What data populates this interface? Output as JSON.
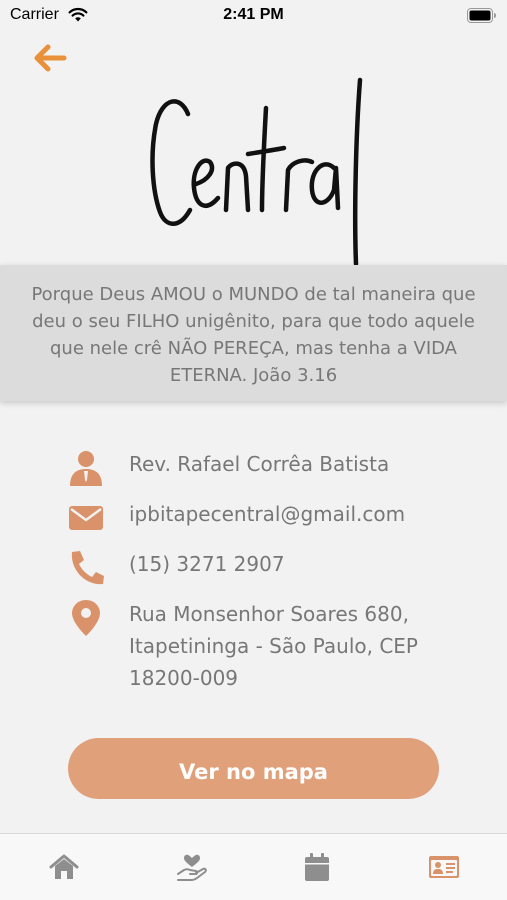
{
  "status_bar": {
    "carrier": "Carrier",
    "time": "2:41 PM"
  },
  "verse": "Porque Deus AMOU o MUNDO de tal maneira que deu o seu FILHO unigênito, para que todo aquele que nele crê NÃO PEREÇA, mas tenha a VIDA ETERNA. João 3.16",
  "contact": {
    "pastor": "Rev. Rafael Corrêa Batista",
    "email": "ipbitapecentral@gmail.com",
    "phone": "(15) 3271 2907",
    "address": "Rua Monsenhor Soares 680, Itapetininga - São Paulo, CEP 18200-009"
  },
  "map_button_label": "Ver no mapa",
  "colors": {
    "accent": "#e0a07a",
    "back_arrow": "#e8913a",
    "icon": "#d9926a",
    "tab_inactive": "#8e8e8e"
  },
  "tabs": [
    {
      "icon": "home-icon"
    },
    {
      "icon": "hand-heart-icon"
    },
    {
      "icon": "calendar-icon"
    },
    {
      "icon": "contact-card-icon",
      "active": true
    }
  ]
}
